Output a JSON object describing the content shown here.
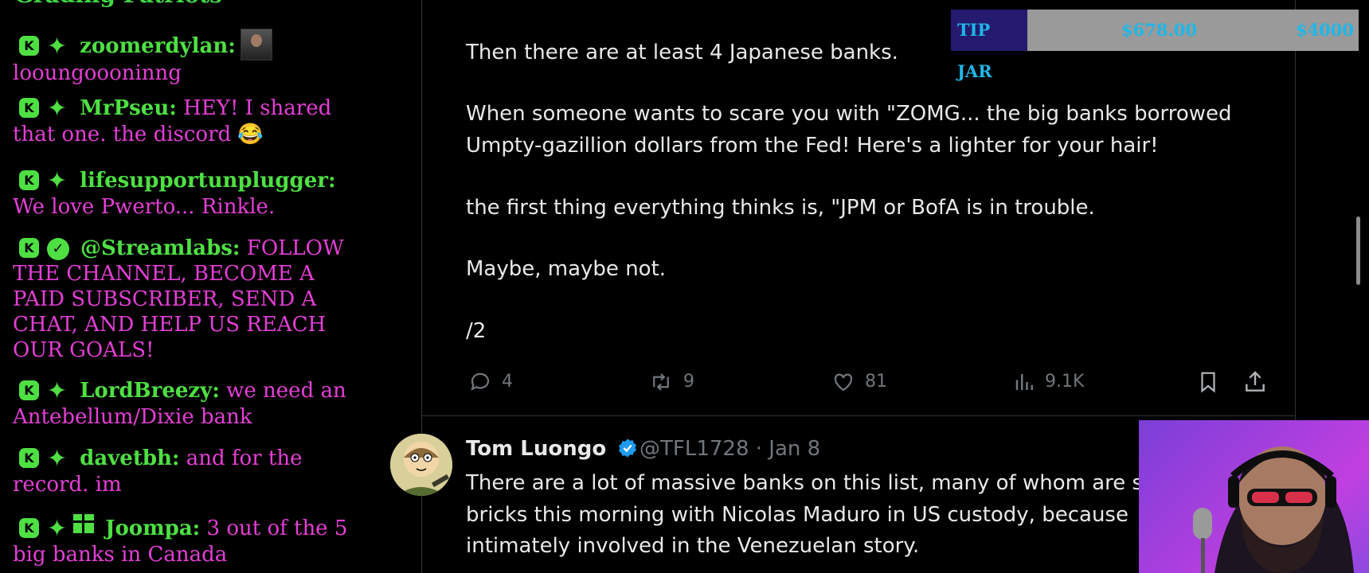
{
  "chat": {
    "cut_header": "Grading Patriots",
    "messages": [
      {
        "user": "zoomerdylan:",
        "text": "looungoooninng"
      },
      {
        "user": "MrPseu:",
        "text": "HEY! I shared that one. the discord 😂"
      },
      {
        "user": "lifesupportunplugger:",
        "text": "We love Pwerto... Rinkle."
      },
      {
        "user": "@Streamlabs:",
        "text": "FOLLOW THE CHANNEL, BECOME A PAID SUBSCRIBER, SEND A CHAT, AND HELP US REACH OUR GOALS!"
      },
      {
        "user": "LordBreezy:",
        "text": "we need an Antebellum/Dixie bank"
      },
      {
        "user": "davetbh:",
        "text": "and for the record. im"
      },
      {
        "user": "Joompa:",
        "text": "3 out of the 5 big banks in Canada"
      }
    ]
  },
  "tipjar": {
    "label": "TIP JAR",
    "current": "$678.00",
    "goal": "$4000",
    "fraction": 0.1695
  },
  "tweet1": {
    "lines": [
      "Then there are at least 4 Japanese banks.",
      "When someone wants to scare you with \"ZOMG... the big banks borrowed",
      "Umpty-gazillion dollars from the Fed!  Here's a lighter for your hair!",
      "the first thing everything thinks is, \"JPM or BofA is in trouble.",
      "Maybe, maybe not.",
      "/2"
    ],
    "replies": "4",
    "reposts": "9",
    "likes": "81",
    "views": "9.1K"
  },
  "tweet2": {
    "name": "Tom Luongo",
    "handle_date": "@TFL1728 · Jan 8",
    "lines": [
      "There are a lot of massive banks on this list, many of whom are s",
      "bricks this morning with Nicolas Maduro in US custody, because",
      "intimately involved in the Venezuelan story."
    ]
  },
  "colors": {
    "chat_name": "#4ee043",
    "chat_text": "#e53fd6",
    "verified": "#1d9bf0",
    "tip_text": "#1fb7e8"
  },
  "icons": [
    "reply-icon",
    "repost-icon",
    "like-icon",
    "views-icon",
    "bookmark-icon",
    "share-icon",
    "verified-icon"
  ]
}
